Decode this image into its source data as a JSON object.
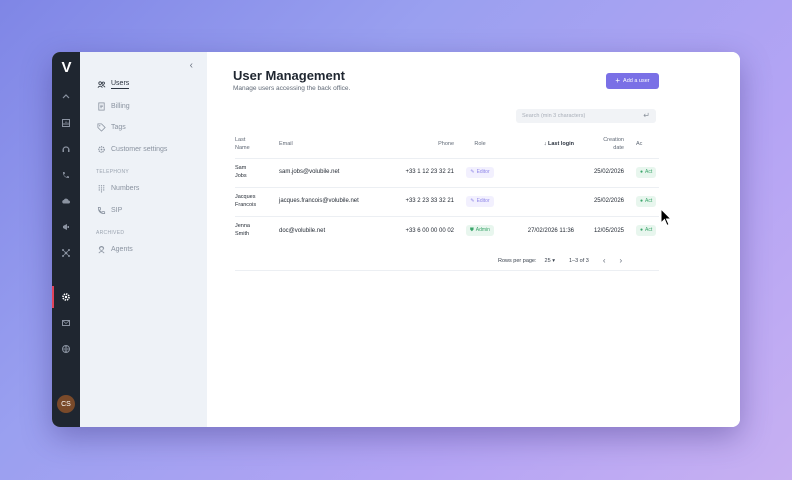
{
  "rail": {
    "logo": "V",
    "avatar": "CS"
  },
  "sidebar": {
    "items": [
      {
        "label": "Users",
        "icon": "users-icon"
      },
      {
        "label": "Billing",
        "icon": "document-icon"
      },
      {
        "label": "Tags",
        "icon": "tag-icon"
      },
      {
        "label": "Customer settings",
        "icon": "gear-icon"
      }
    ],
    "telephony_section": "TELEPHONY",
    "telephony_items": [
      {
        "label": "Numbers",
        "icon": "dialpad-icon"
      },
      {
        "label": "SIP",
        "icon": "phone-icon"
      }
    ],
    "archived_section": "ARCHIVED",
    "archived_items": [
      {
        "label": "Agents",
        "icon": "agent-icon"
      }
    ]
  },
  "main": {
    "title": "User Management",
    "subtitle": "Manage users accessing the back office.",
    "add_button": "Add a user",
    "search_placeholder": "Search (min 3 characters)"
  },
  "table": {
    "headers": {
      "last_name_1": "Last",
      "last_name_2": "Name",
      "email": "Email",
      "phone": "Phone",
      "role": "Role",
      "last_login": "Last login",
      "creation_1": "Creation",
      "creation_2": "date",
      "actions": "Ac"
    },
    "rows": [
      {
        "first": "Sam",
        "second": "Jobs",
        "email": "sam.jobs@volubile.net",
        "phone": "+33 1 12 23 32 21",
        "role": "Editor",
        "last_login": "",
        "creation": "25/02/2026",
        "status": "Act"
      },
      {
        "first": "Jacques",
        "second": "Francois",
        "email": "jacques.francois@volubile.net",
        "phone": "+33 2 23 33 32 21",
        "role": "Editor",
        "last_login": "",
        "creation": "25/02/2026",
        "status": "Act"
      },
      {
        "first": "Jenna",
        "second": "Smith",
        "email": "doc@volubile.net",
        "phone": "+33 6 00 00 00 02",
        "role": "Admin",
        "last_login": "27/02/2026 11:36",
        "creation": "12/05/2025",
        "status": "Act"
      }
    ]
  },
  "pagination": {
    "rows_per_page_label": "Rows per page:",
    "rows_per_page_value": "25",
    "range": "1–3 of 3"
  },
  "colors": {
    "accent": "#7a70e6",
    "rail": "#1f2630",
    "sidebar": "#eef2f7",
    "active_marker": "#e0445a",
    "success": "#3aa56a"
  }
}
